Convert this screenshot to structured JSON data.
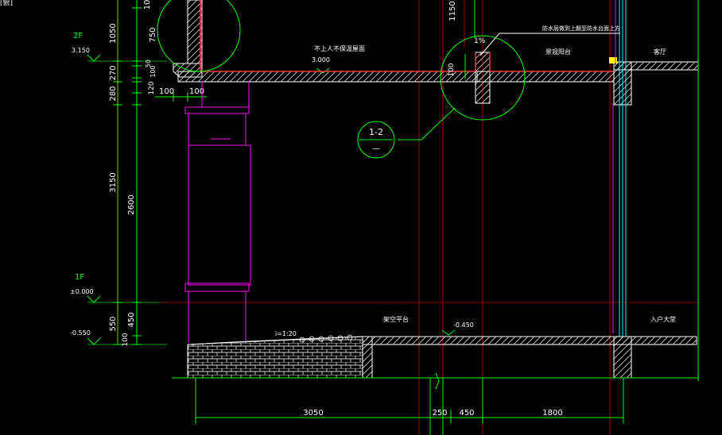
{
  "window": {
    "corner_label": "[俯]"
  },
  "levels": {
    "f2_name": "2F",
    "f2_elev": "3.150",
    "f1_name": "1F",
    "f1_elev": "±0.000",
    "bottom_elev": "-0.550"
  },
  "dims_vertical_outer": {
    "d1050": "1050",
    "d270": "270",
    "d280": "280",
    "d3150": "3150",
    "d550": "550"
  },
  "dims_vertical_inner": {
    "d10": "10",
    "d750": "750",
    "d50": "50",
    "d100": "100",
    "d120": "120",
    "d2600": "2600",
    "d450": "450",
    "d100b": "100"
  },
  "dims_small": {
    "w100a": "100",
    "w100b": "100",
    "h1150": "1150",
    "h100": "100",
    "slope": "1%"
  },
  "dims_bottom": {
    "d3050": "3050",
    "d250": "250",
    "d450": "450",
    "d1800": "1800"
  },
  "annotations": {
    "roof_note": "不上人不保温屋面",
    "roof_elev": "3.000",
    "parapet_note": "防水层做到上翻至防水台面上方",
    "balcony_left": "景观阳台",
    "balcony_right": "客厅",
    "ground_note": "架空平台",
    "ground_elev": "-0.450",
    "ramp_slope": "i=1:20",
    "entrance": "入户大堂"
  },
  "detail_callout": {
    "number": "1-2",
    "sheet": "—"
  },
  "colors": {
    "dim": "#00ff00",
    "wall": "#ffffff",
    "column": "#ff00ff",
    "axis": "#cc0000",
    "text": "#ffffff",
    "glass": "#00ffff",
    "callout": "#00ff00"
  }
}
